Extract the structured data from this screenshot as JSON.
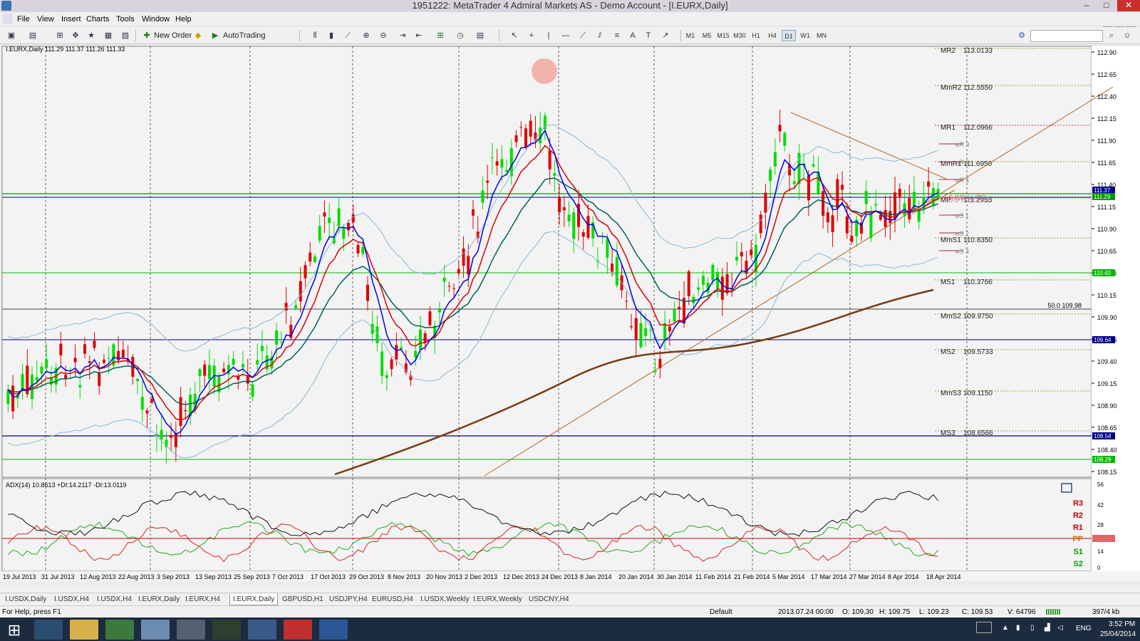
{
  "window": {
    "title": "1951222: MetaTrader 4 Admiral Markets AS - Demo Account - [I.EURX,Daily]",
    "btn_min": "–",
    "btn_max": "□",
    "btn_close": "✕"
  },
  "menu": [
    "File",
    "View",
    "Insert",
    "Charts",
    "Tools",
    "Window",
    "Help"
  ],
  "toolbar": {
    "new_order": "New Order",
    "autotrading": "AutoTrading",
    "timeframes": [
      "M1",
      "M5",
      "M15",
      "M30",
      "H1",
      "H4",
      "D1",
      "W1",
      "MN"
    ],
    "active_tf": "D1"
  },
  "chart": {
    "header": "I.EURX,Daily  111.29 111.37 111.26 111.33",
    "price_axis": [
      "112.90",
      "112.65",
      "112.40",
      "112.15",
      "111.90",
      "111.65",
      "111.40",
      "111.15",
      "110.90",
      "110.65",
      "110.40",
      "110.15",
      "109.90",
      "109.65",
      "109.40",
      "109.15",
      "108.90",
      "108.65",
      "108.40",
      "108.15"
    ],
    "date_axis": [
      "19 Jul 2013",
      "31 Jul 2013",
      "12 Aug 2013",
      "22 Aug 2013",
      "3 Sep 2013",
      "13 Sep 2013",
      "25 Sep 2013",
      "7 Oct 2013",
      "17 Oct 2013",
      "29 Oct 2013",
      "8 Nov 2013",
      "20 Nov 2013",
      "2 Dec 2013",
      "12 Dec 2013",
      "24 Dec 2013",
      "8 Jan 2014",
      "20 Jan 2014",
      "30 Jan 2014",
      "11 Feb 2014",
      "21 Feb 2014",
      "5 Mar 2014",
      "17 Mar 2014",
      "27 Mar 2014",
      "8 Apr 2014",
      "18 Apr 2014"
    ],
    "pivots": [
      {
        "label": "MR2",
        "value": "113.0133"
      },
      {
        "label": "MmR2",
        "value": "112.5550"
      },
      {
        "label": "MR1",
        "value": "112.0966"
      },
      {
        "label": "MmR1",
        "value": "111.6950"
      },
      {
        "label": "MP",
        "value": "111.2933"
      },
      {
        "label": "MmS1",
        "value": "110.8350"
      },
      {
        "label": "MS1",
        "value": "110.3766"
      },
      {
        "label": "MmS2",
        "value": "109.9750"
      },
      {
        "label": "MS2",
        "value": "109.5733"
      },
      {
        "label": "MmS3",
        "value": "109.1150"
      },
      {
        "label": "MS3",
        "value": "108.6566"
      }
    ],
    "weekly_labels": [
      "wR 3",
      "wR 2",
      "wR 1",
      "Weekly Pivot",
      "wS 1",
      "wS 2",
      "wS 3"
    ],
    "price_tags": [
      "111.37",
      "111.29",
      "110.40",
      "109.64",
      "108.54",
      "108.29"
    ],
    "fib_label": "50.0  109.98",
    "watermark": "9071.77",
    "indicator": {
      "header": "ADX(14) 10.8613 +DI:14.2117 -DI:13.0119",
      "scale": [
        "56",
        "42",
        "28",
        "20.00",
        "14",
        "0"
      ],
      "pivot_marks": [
        "R3",
        "R2",
        "R1",
        "PP",
        "S1",
        "S2"
      ]
    },
    "colors": {
      "bull": "#00dd00",
      "bear": "#e00000",
      "ema_fast": "#0000ee",
      "ema_slow": "#006060",
      "bollinger": "#87b9d8",
      "ma200": "#7a3a10"
    }
  },
  "tabs": [
    "I.USDX,Daily",
    "I.USDX,H4",
    "I.USDX,H4",
    "I.EURX,Daily",
    "I.EURX,H4",
    "I.EURX,Daily",
    "GBPUSD,H1",
    "USDJPY,H4",
    "EURUSD,H4",
    "I.USDX,Weekly",
    "I.EURX,Weekly",
    "USDCNY,H4"
  ],
  "active_tab": 5,
  "status": {
    "help": "For Help, press F1",
    "profile": "Default",
    "datetime": "2013.07.24 00:00",
    "open": "O: 109.30",
    "high": "H: 109.75",
    "low": "L: 109.23",
    "close": "C: 109.53",
    "volume": "V: 64796",
    "traffic": "397/4 kb"
  },
  "taskbar": {
    "lang": "ENG",
    "time": "3:52 PM",
    "date": "25/04/2014"
  }
}
